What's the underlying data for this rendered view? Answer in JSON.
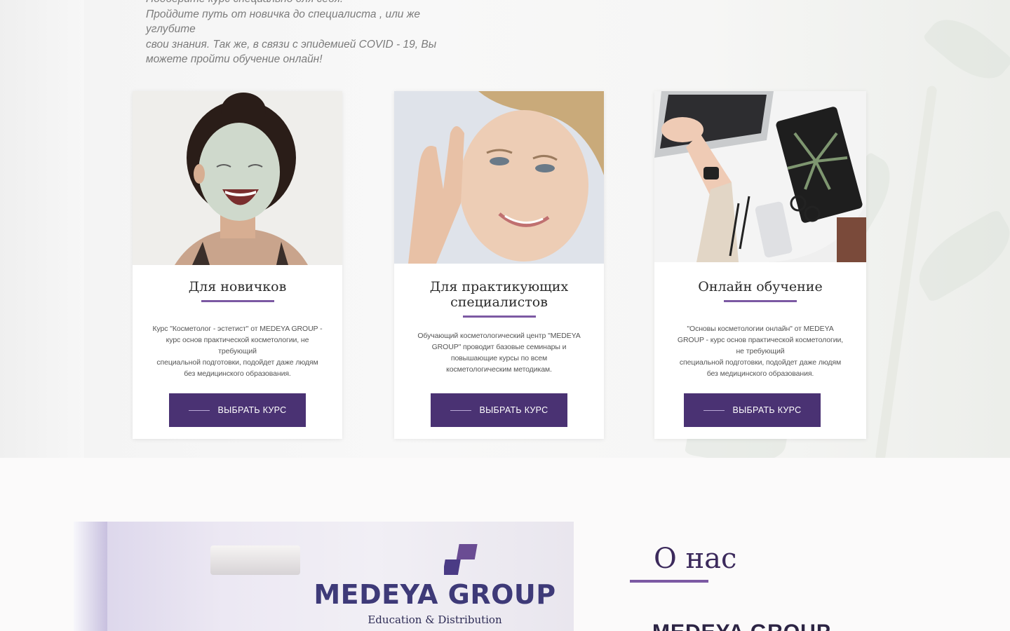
{
  "intro": {
    "line0": "Подберите курс специально для себя.",
    "line1": "Пройдите путь от новичка до специалиста , или же углубите",
    "line2": "свои знания. Так же, в связи с эпидемией COVID - 19, Вы",
    "line3": "можете пройти обучение онлайн!"
  },
  "cards": [
    {
      "title": "Для новичков",
      "desc": [
        "Курс \"Косметолог - эстетист\" от  MEDEYA GROUP -",
        "курс основ практической косметологии, не",
        "требующий",
        "специальной подготовки, подойдет даже людям",
        "без медицинского образования."
      ],
      "button": "ВЫБРАТЬ КУРС"
    },
    {
      "title_line1": "Для практикующих",
      "title_line2": "специалистов",
      "desc": [
        "Обучающий косметологический центр \"MEDEYA",
        "GROUP\" проводит базовые семинары и",
        "повышающие курсы по всем",
        "косметологическим методикам."
      ],
      "button": "ВЫБРАТЬ КУРС"
    },
    {
      "title": "Онлайн обучение",
      "desc": [
        "\"Основы косметологии онлайн\" от  MEDEYA",
        "GROUP - курс основ практической косметологии,",
        "не требующий",
        "специальной подготовки, подойдет даже людям",
        "без медицинского образования."
      ],
      "button": "ВЫБРАТЬ КУРС"
    }
  ],
  "about": {
    "sign_name": "MEDEYA GROUP",
    "sign_sub": "Education & Distribution",
    "title": "О нас",
    "heading": "MEDEYA GROUP"
  },
  "colors": {
    "accent": "#7c59a3",
    "button": "#4a3273"
  }
}
